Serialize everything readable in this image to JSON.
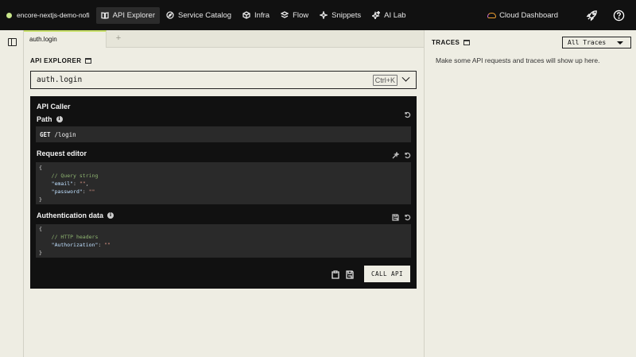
{
  "app": {
    "name": "encore-nextjs-demo-nofi",
    "status_color": "#c8e68a"
  },
  "nav": [
    {
      "label": "API Explorer",
      "icon": "book-icon",
      "active": true
    },
    {
      "label": "Service Catalog",
      "icon": "compass-icon"
    },
    {
      "label": "Infra",
      "icon": "cube-icon"
    },
    {
      "label": "Flow",
      "icon": "flow-icon"
    },
    {
      "label": "Snippets",
      "icon": "sparkle-icon"
    },
    {
      "label": "AI Lab",
      "icon": "ai-sparkle-icon"
    }
  ],
  "topright": {
    "cloud_label": "Cloud Dashboard",
    "rocket_icon": "rocket-icon",
    "help_icon": "help-icon"
  },
  "tabs": {
    "active": "auth.login",
    "add": "+"
  },
  "explorer": {
    "title": "API EXPLORER",
    "endpoint": "auth.login",
    "shortcut": "Ctrl+K"
  },
  "caller": {
    "title": "API Caller",
    "path_label": "Path",
    "method": "GET",
    "path": "/login",
    "request_label": "Request editor",
    "request_lines": [
      {
        "t": "{",
        "c": ""
      },
      {
        "t": "    // Query string",
        "c": "c-comment"
      },
      {
        "k": "    \"email\"",
        "s": "\"\"",
        "tail": ","
      },
      {
        "k": "    \"password\"",
        "s": "\"\"",
        "tail": ""
      },
      {
        "t": "}",
        "c": ""
      }
    ],
    "auth_label": "Authentication data",
    "auth_lines": [
      {
        "t": "{",
        "c": ""
      },
      {
        "t": "    // HTTP headers",
        "c": "c-comment"
      },
      {
        "k": "    \"Authorization\"",
        "s": "\"\"",
        "tail": ""
      },
      {
        "t": "}",
        "c": ""
      }
    ],
    "call_button": "CALL API"
  },
  "traces": {
    "title": "TRACES",
    "filter": "All Traces",
    "empty": "Make some API requests and traces will show up here."
  },
  "colors": {
    "topbar": "#111111",
    "background": "#eeede3",
    "panel": "#111111",
    "code_bg": "#2a2a2a",
    "tab_accent": "#c8e06a"
  }
}
